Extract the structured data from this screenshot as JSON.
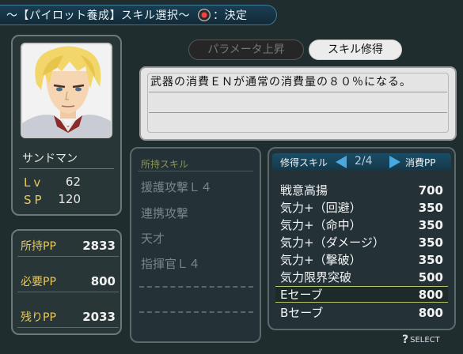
{
  "header": {
    "title": "～【パイロット養成】スキル選択～",
    "confirm_label": "：決定"
  },
  "pilot": {
    "name": "サンドマン",
    "stats": [
      {
        "label": "Lv",
        "value": "62"
      },
      {
        "label": "SP",
        "value": "120"
      }
    ]
  },
  "pp": {
    "owned_label": "所持PP",
    "owned_value": "2833",
    "required_label": "必要PP",
    "required_value": "800",
    "remaining_label": "残りPP",
    "remaining_value": "2033"
  },
  "tabs": {
    "params": "パラメータ上昇",
    "skills": "スキル修得"
  },
  "description": "武器の消費ＥＮが通常の消費量の８０％になる。",
  "owned_skills": {
    "header": "所持スキル",
    "items": [
      "援護攻撃Ｌ４",
      "連携攻撃",
      "天才",
      "指揮官Ｌ４"
    ]
  },
  "learnable": {
    "title": "修得スキル",
    "page": "2/4",
    "cost_header": "消費PP",
    "items": [
      {
        "name": "戦意高揚",
        "cost": "700"
      },
      {
        "name": "気力+（回避）",
        "cost": "350"
      },
      {
        "name": "気力+（命中）",
        "cost": "350"
      },
      {
        "name": "気力+（ダメージ）",
        "cost": "350"
      },
      {
        "name": "気力+（撃破）",
        "cost": "350"
      },
      {
        "name": "気力限界突破",
        "cost": "500"
      },
      {
        "name": "Eセーブ",
        "cost": "800"
      },
      {
        "name": "Bセーブ",
        "cost": "800"
      }
    ],
    "selected_index": 6
  },
  "hint": {
    "select_label": "SELECT"
  },
  "colors": {
    "background": "#1f2d2f",
    "accent_gold": "#e8c85a",
    "accent_blue": "#4aa8e0",
    "selection": "#b8c46a"
  }
}
